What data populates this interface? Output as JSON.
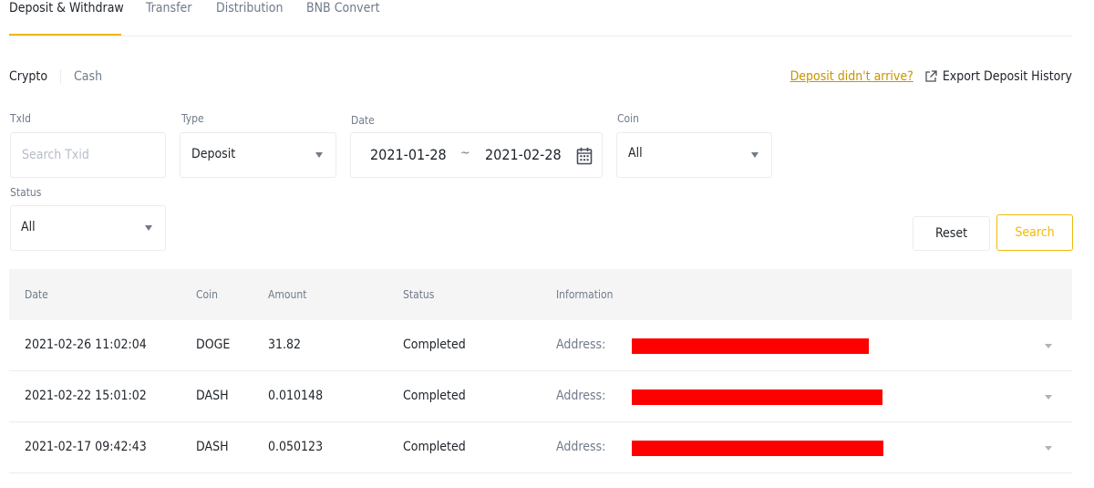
{
  "tabs": [
    {
      "label": "Deposit & Withdraw",
      "active": true
    },
    {
      "label": "Transfer",
      "active": false
    },
    {
      "label": "Distribution",
      "active": false
    },
    {
      "label": "BNB Convert",
      "active": false
    }
  ],
  "subtabs": [
    {
      "label": "Crypto",
      "active": true
    },
    {
      "label": "Cash",
      "active": false
    }
  ],
  "links": {
    "deposit_not_arrived": "Deposit didn't arrive?",
    "export_history": "Export Deposit History"
  },
  "filters": {
    "txid": {
      "label": "TxId",
      "placeholder": "Search Txid",
      "value": ""
    },
    "type": {
      "label": "Type",
      "value": "Deposit"
    },
    "date": {
      "label": "Date",
      "start": "2021-01-28",
      "separator": "~",
      "end": "2021-02-28"
    },
    "coin": {
      "label": "Coin",
      "value": "All"
    },
    "status": {
      "label": "Status",
      "value": "All"
    }
  },
  "buttons": {
    "reset": "Reset",
    "search": "Search"
  },
  "table": {
    "headers": {
      "date": "Date",
      "coin": "Coin",
      "amount": "Amount",
      "status": "Status",
      "information": "Information"
    },
    "rows": [
      {
        "date": "2021-02-26 11:02:04",
        "coin": "DOGE",
        "amount": "31.82",
        "status": "Completed",
        "info_label": "Address:"
      },
      {
        "date": "2021-02-22 15:01:02",
        "coin": "DASH",
        "amount": "0.010148",
        "status": "Completed",
        "info_label": "Address:"
      },
      {
        "date": "2021-02-17 09:42:43",
        "coin": "DASH",
        "amount": "0.050123",
        "status": "Completed",
        "info_label": "Address:"
      }
    ]
  },
  "colors": {
    "accent": "#f0b90b",
    "link": "#c99400",
    "redaction": "#ff0000"
  }
}
